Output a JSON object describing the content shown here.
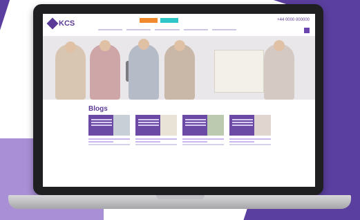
{
  "site": {
    "brand": "KCS",
    "phone": "+44 0000 000000"
  },
  "blogs": {
    "title": "Blogs",
    "items": [
      {
        "label": ""
      },
      {
        "label": ""
      },
      {
        "label": ""
      },
      {
        "label": ""
      }
    ]
  },
  "colors": {
    "brand_purple": "#5a3a96",
    "accent_orange": "#f08a2c",
    "accent_teal": "#2ec5c8"
  }
}
